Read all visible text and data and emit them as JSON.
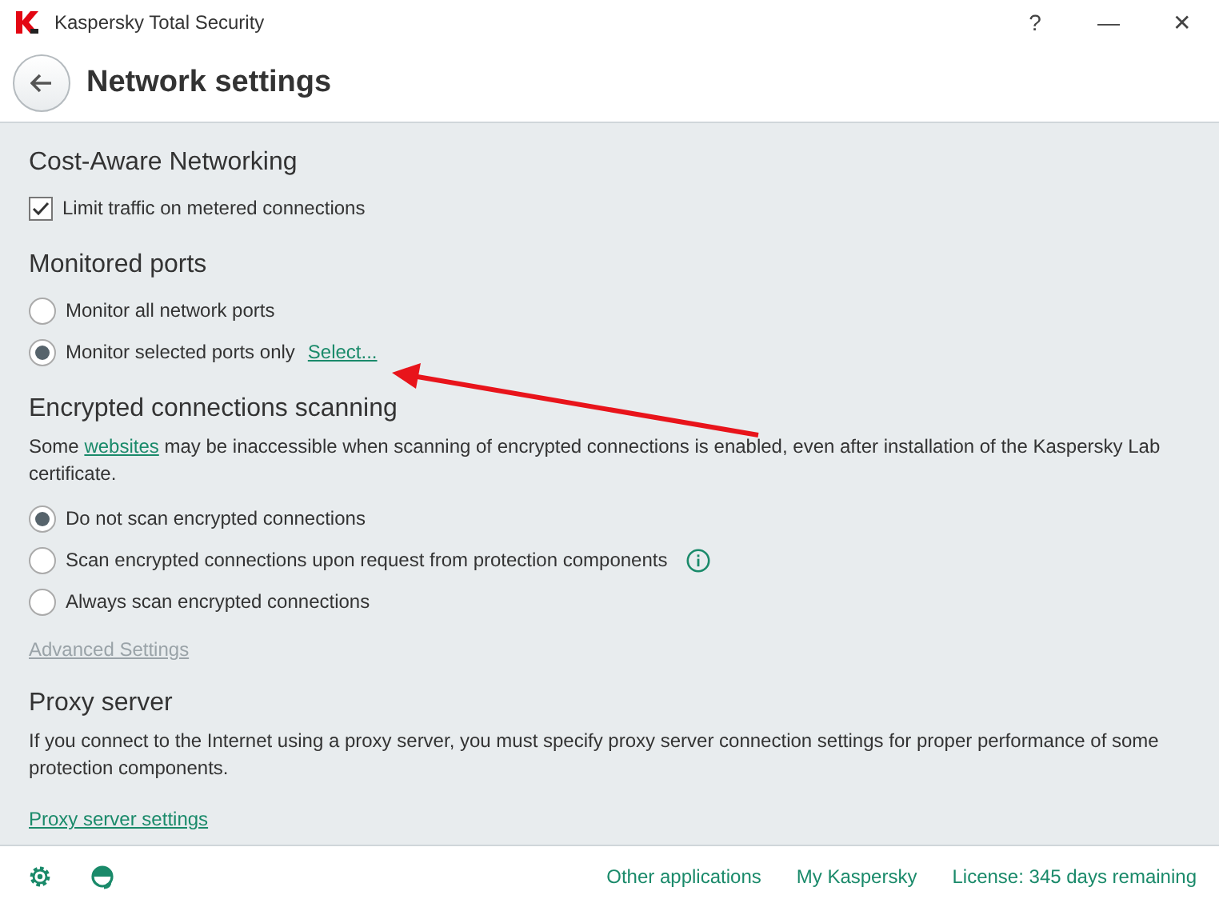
{
  "window": {
    "title": "Kaspersky Total Security",
    "buttons": [
      "?",
      "—",
      "✕"
    ]
  },
  "header": {
    "title": "Network settings"
  },
  "sections": [
    {
      "title": "Cost-Aware Networking",
      "options": [
        {
          "kind": "checkbox",
          "label": "Limit traffic on metered connections",
          "checked": true
        }
      ]
    },
    {
      "title": "Monitored ports",
      "options": [
        {
          "kind": "radio",
          "label": "Monitor all network ports",
          "selected": false
        },
        {
          "kind": "radio",
          "label": "Monitor selected ports only",
          "selected": true,
          "link": "Select..."
        }
      ]
    },
    {
      "title": "Encrypted connections scanning",
      "description": {
        "before": "Some",
        "link": "websites",
        "after": "may be inaccessible when scanning of encrypted connections is enabled, even after installation of the Kaspersky Lab certificate."
      },
      "options": [
        {
          "kind": "radio",
          "label": "Do not scan encrypted connections",
          "selected": true
        },
        {
          "kind": "radio",
          "label": "Scan encrypted connections upon request from protection components",
          "selected": false,
          "info": true
        },
        {
          "kind": "radio",
          "label": "Always scan encrypted connections",
          "selected": false
        }
      ],
      "footer_link": {
        "label": "Advanced Settings",
        "disabled": true
      }
    },
    {
      "title": "Proxy server",
      "description": {
        "before": "If you connect to the Internet using a proxy server, you must specify proxy server connection settings for proper performance of some protection components."
      },
      "footer_link": {
        "label": "Proxy server settings",
        "disabled": false
      }
    }
  ],
  "footer": {
    "links": [
      "Other applications",
      "My Kaspersky",
      "License: 345 days remaining"
    ]
  }
}
